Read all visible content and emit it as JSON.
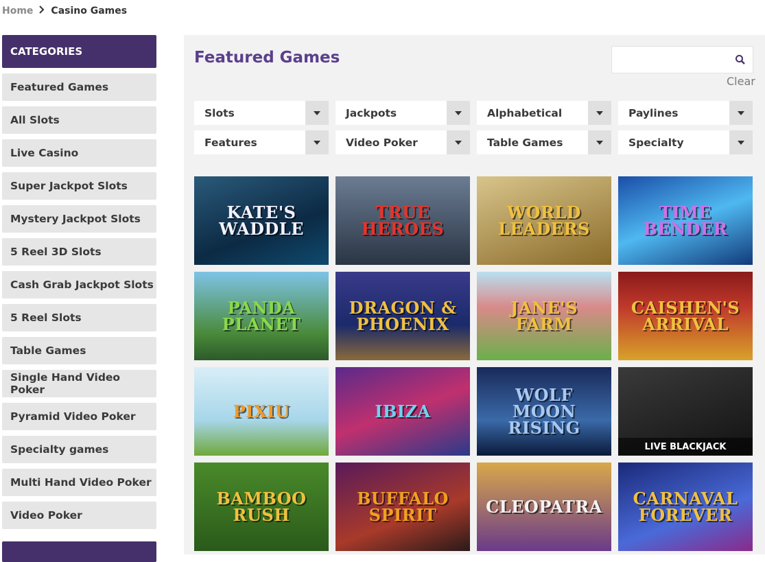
{
  "breadcrumb": {
    "home": "Home",
    "current": "Casino Games"
  },
  "sidebar": {
    "header": "CATEGORIES",
    "items": [
      "Featured Games",
      "All Slots",
      "Live Casino",
      "Super Jackpot Slots",
      "Mystery Jackpot Slots",
      "5 Reel 3D Slots",
      "Cash Grab Jackpot Slots",
      "5 Reel Slots",
      "Table Games",
      "Single Hand Video Poker",
      "Pyramid Video Poker",
      "Specialty games",
      "Multi Hand Video Poker",
      "Video Poker"
    ]
  },
  "main": {
    "title": "Featured Games",
    "search": {
      "placeholder": "",
      "clear": "Clear"
    },
    "filters": [
      "Slots",
      "Jackpots",
      "Alphabetical",
      "Paylines",
      "Features",
      "Video Poker",
      "Table Games",
      "Specialty"
    ],
    "games": [
      {
        "title": "KATE'S WADDLE",
        "style": "t-blue-water",
        "color": "#f2f2ff"
      },
      {
        "title": "TRUE HEROES",
        "style": "t-city",
        "color": "#e8332a"
      },
      {
        "title": "WORLD LEADERS",
        "style": "t-olive",
        "color": "#f0c040"
      },
      {
        "title": "TIME BENDER",
        "style": "t-lightning",
        "color": "#d070e8"
      },
      {
        "title": "PANDA PLANET",
        "style": "t-panda",
        "color": "#8ad84a"
      },
      {
        "title": "DRAGON & PHOENIX",
        "style": "t-dragon",
        "color": "#f0c040"
      },
      {
        "title": "JANE'S FARM",
        "style": "t-farm",
        "color": "#f0c040"
      },
      {
        "title": "CAISHEN'S ARRIVAL",
        "style": "t-gold",
        "color": "#f0c040"
      },
      {
        "title": "PIXIU",
        "style": "t-pixiu",
        "color": "#f09a2a"
      },
      {
        "title": "IBIZA",
        "style": "t-ibiza",
        "color": "#70d0f0"
      },
      {
        "title": "WOLF MOON RISING",
        "style": "t-wolf",
        "color": "#a8c8f0"
      },
      {
        "title": "",
        "style": "t-blackjack",
        "color": "#ffffff",
        "caption": "LIVE BLACKJACK"
      },
      {
        "title": "BAMBOO RUSH",
        "style": "t-bamboo",
        "color": "#f0c040"
      },
      {
        "title": "BUFFALO SPIRIT",
        "style": "t-buffalo",
        "color": "#f0a020"
      },
      {
        "title": "CLEOPATRA",
        "style": "t-cleo",
        "color": "#f2f2f2"
      },
      {
        "title": "CARNAVAL FOREVER",
        "style": "t-carnaval",
        "color": "#f0c040"
      }
    ]
  }
}
